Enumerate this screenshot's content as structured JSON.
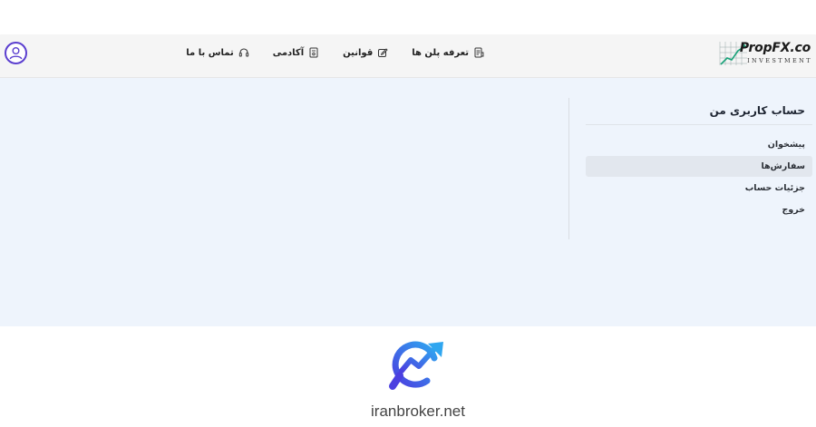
{
  "header": {
    "logo_text": "PropFX.co",
    "logo_subtext": "INVESTMENT",
    "nav_items": [
      {
        "label": "تعرفه پلن ها",
        "icon": "pricing-icon"
      },
      {
        "label": "قوانین",
        "icon": "edit-icon"
      },
      {
        "label": "آکادمی",
        "icon": "academy-icon"
      },
      {
        "label": "تماس با ما",
        "icon": "headset-icon"
      }
    ],
    "avatar_icon": "user-circle-icon"
  },
  "sidebar": {
    "title": "حساب کاربری من",
    "items": [
      {
        "label": "پیشخوان",
        "active": false
      },
      {
        "label": "سفارش‌ها",
        "active": true
      },
      {
        "label": "جزئیات حساب",
        "active": false
      },
      {
        "label": "خروج",
        "active": false
      }
    ]
  },
  "watermark": {
    "text": "iranbroker.net",
    "icon": "trend-magnifier-logo-icon"
  },
  "colors": {
    "navbar_bg": "#f5f5f5",
    "content_bg": "#eef4fc",
    "avatar_border": "#5b3fcf",
    "active_item_bg": "#e2e7ee"
  }
}
